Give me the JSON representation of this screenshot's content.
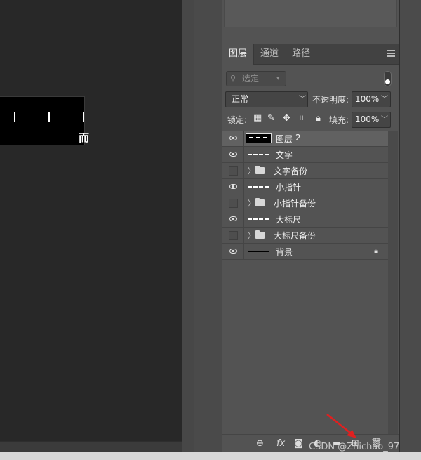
{
  "canvas": {
    "doc_glyph": "而"
  },
  "tabs": [
    {
      "label": "图层",
      "active": true
    },
    {
      "label": "通道",
      "active": false
    },
    {
      "label": "路径",
      "active": false
    }
  ],
  "filter": {
    "placeholder": "选定",
    "icon": "search-icon"
  },
  "blend": {
    "mode": "正常",
    "opacity_label": "不透明度:",
    "opacity_value": "100%"
  },
  "lock": {
    "label": "锁定:",
    "fill_label": "填充:",
    "fill_value": "100%"
  },
  "layers": [
    {
      "name": "图层",
      "suffix": "2",
      "visible": true,
      "type": "dashed",
      "selected": true
    },
    {
      "name": "文字",
      "visible": true,
      "type": "dashed"
    },
    {
      "name": "文字备份",
      "visible": false,
      "type": "folder"
    },
    {
      "name": "小指针",
      "visible": true,
      "type": "dashed"
    },
    {
      "name": "小指针备份",
      "visible": false,
      "type": "folder"
    },
    {
      "name": "大标尺",
      "visible": true,
      "type": "dashed"
    },
    {
      "name": "大标尺备份",
      "visible": false,
      "type": "folder"
    },
    {
      "name": "背景",
      "visible": true,
      "type": "solid",
      "locked": true
    }
  ],
  "bottom_toolbar": {
    "link": "link-icon",
    "fx": "fx",
    "mask": "mask-icon",
    "adjust": "adjustment-icon",
    "group": "folder-icon",
    "new_layer": "new-layer-icon",
    "delete": "trash-icon"
  },
  "watermark": "CSDN @Zhichao_97",
  "colors": {
    "guide": "#5fd3d6",
    "arrow": "#e02020",
    "panel": "#535353"
  }
}
